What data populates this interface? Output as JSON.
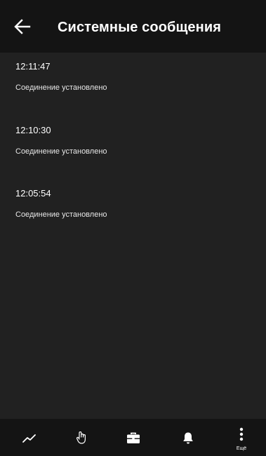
{
  "header": {
    "title": "Системные сообщения",
    "back_icon": "arrow-left-icon"
  },
  "messages": [
    {
      "time": "12:11:47",
      "text": "Соединение установлено"
    },
    {
      "time": "12:10:30",
      "text": "Соединение установлено"
    },
    {
      "time": "12:05:54",
      "text": "Соединение установлено"
    }
  ],
  "bottom_nav": {
    "items": [
      {
        "icon": "chart-trend-icon",
        "label": ""
      },
      {
        "icon": "hand-pointer-icon",
        "label": ""
      },
      {
        "icon": "briefcase-icon",
        "label": ""
      },
      {
        "icon": "bell-icon",
        "label": ""
      },
      {
        "icon": "more-vertical-icon",
        "label": "Ещё"
      }
    ]
  },
  "colors": {
    "background": "#212121",
    "bars": "#141414",
    "text": "#ffffff"
  }
}
